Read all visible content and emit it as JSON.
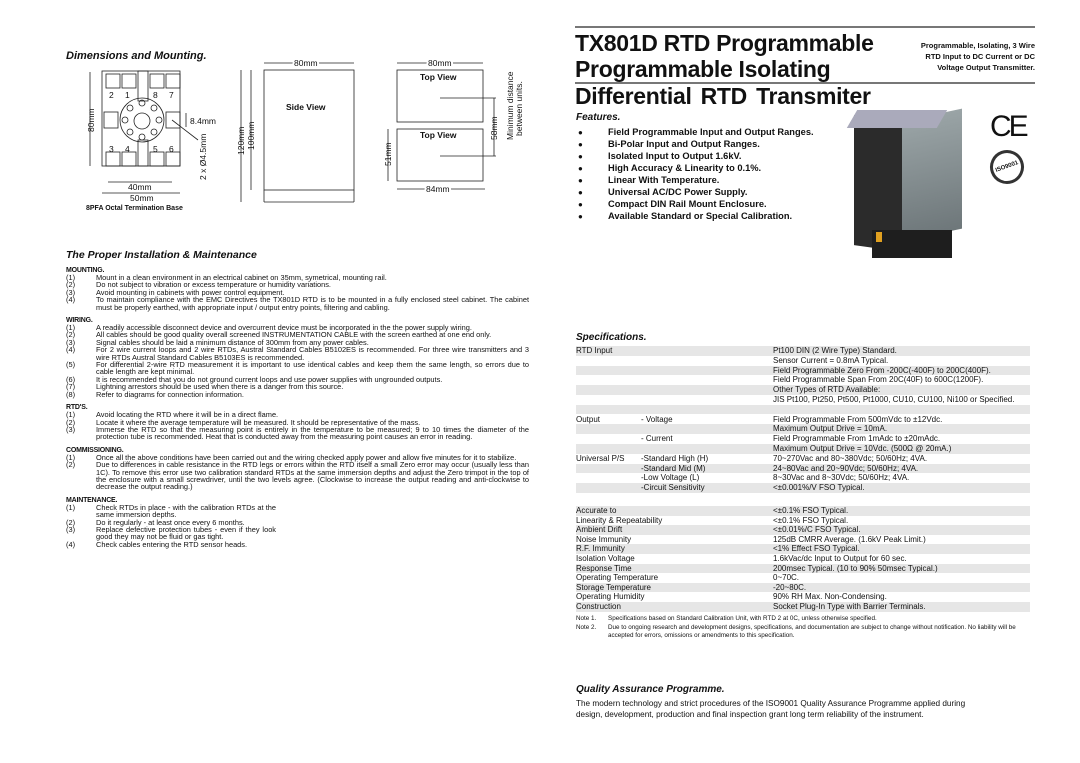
{
  "dimensions": {
    "heading": "Dimensions and Mounting.",
    "base_label": "8PFA Octal Termination Base",
    "base_terminals": [
      "2",
      "1",
      "8",
      "7",
      "3",
      "4",
      "5",
      "6"
    ],
    "dim_80mm_height": "80mm",
    "dim_8_4mm": "8.4mm",
    "dim_holes": "2 x Ø4.5mm",
    "dim_40mm": "40mm",
    "dim_50mm": "50mm",
    "side_view_label": "Side View",
    "side_width": "80mm",
    "side_120mm": "120mm",
    "side_100mm": "100mm",
    "top_view_label": "Top View",
    "top_width": "80mm",
    "top_51mm": "51mm",
    "top_84mm": "84mm",
    "top_58mm": "58mm",
    "min_distance": [
      "Minimum distance",
      "between units."
    ]
  },
  "installation": {
    "heading": "The Proper Installation & Maintenance",
    "sections": [
      {
        "title": "MOUNTING.",
        "items": [
          {
            "n": "(1)",
            "t": "Mount in a clean environment in an electrical cabinet on 35mm, symetrical, mounting rail."
          },
          {
            "n": "(2)",
            "t": "Do not subject to vibration or excess temperature or humidity variations."
          },
          {
            "n": "(3)",
            "t": "Avoid mounting in cabinets with power control equipment."
          },
          {
            "n": "(4)",
            "t": "To maintain compliance with the EMC Directives the TX801D RTD is to be mounted in a fully enclosed steel cabinet. The cabinet  must be properly earthed, with appropriate input / output entry points, filtering and cabling."
          }
        ]
      },
      {
        "title": "WIRING.",
        "items": [
          {
            "n": "(1)",
            "t": "A readily accessible disconnect device and overcurrent device must be incorporated in the the power supply wiring."
          },
          {
            "n": "(2)",
            "t": "All cables should be good quality overall screened INSTRUMENTATION CABLE with the screen earthed at one end only."
          },
          {
            "n": "(3)",
            "t": "Signal cables should be laid a minimum distance of 300mm from any power cables."
          },
          {
            "n": "(4)",
            "t": "For 2 wire current loops and 2 wire RTDs, Austral Standard Cables B5102ES is recommended.  For three wire transmitters and 3 wire RTDs Austral Standard Cables B5103ES is recommended."
          },
          {
            "n": "(5)",
            "t": "For differential 2-wire RTD measurement it is important to use identical cables and keep them the same length, so errors due to cable length are kept minimal."
          },
          {
            "n": "(6)",
            "t": "It is recommended that you do not ground current loops and use power supplies with ungrounded outputs."
          },
          {
            "n": "(7)",
            "t": "Lightning arrestors should be used when there is a danger from this source."
          },
          {
            "n": "(8)",
            "t": "Refer to diagrams for connection information."
          }
        ]
      },
      {
        "title": "RTD'S.",
        "items": [
          {
            "n": "(1)",
            "t": "Avoid locating the RTD where it will be in a direct flame."
          },
          {
            "n": "(2)",
            "t": "Locate it where the average temperature will be measured.  It should be representative of the mass."
          },
          {
            "n": "(3)",
            "t": "Immerse the RTD so that the measuring point is entirely in the temperature to be measured; 9 to 10 times the diameter of the protection tube is recommended. Heat that is conducted away from the measuring point causes an error in reading."
          }
        ]
      },
      {
        "title": "COMMISSIONING.",
        "items": [
          {
            "n": "(1)",
            "t": "Once all the above conditions have been carried out and the wiring checked apply power  and allow five minutes for it to stabilize."
          },
          {
            "n": "(2)",
            "t": "Due to differences in cable resistance in the RTD legs or errors within the RTD itself a small Zero error may occur (usually less than 1C).  To remove this error use two calibration standard RTDs at the same immersion depths and adjust the Zero trimpot in the top of the  enclosure with a small screwdriver, until the two levels agree. (Clockwise to increase the output reading and anti-clockwise to decrease the output reading.)"
          }
        ]
      },
      {
        "title": "MAINTENANCE.",
        "items": [
          {
            "n": "(1)",
            "t": "Check RTDs in place - with the calibration RTDs at the same immersion depths."
          },
          {
            "n": "(2)",
            "t": "Do it regularly - at least once every 6 months."
          },
          {
            "n": "(3)",
            "t": "Replace defective protection tubes - even if they look good they may not be fluid or gas tight."
          },
          {
            "n": "(4)",
            "t": "Check cables entering the RTD sensor heads."
          }
        ]
      }
    ]
  },
  "header": {
    "title_lines": [
      "TX801D RTD Programmable",
      "Programmable Isolating",
      "Differential  RTD  Transmiter"
    ],
    "subtitle": [
      "Programmable, Isolating, 3 Wire",
      "RTD Input to DC Current or DC",
      "Voltage Output Transmitter."
    ],
    "ce_mark": "CE",
    "iso_badge": "ISO9001"
  },
  "features": {
    "heading": "Features.",
    "items": [
      "Field Programmable Input and Output Ranges.",
      "Bi-Polar Input and Output Ranges.",
      "Isolated Input to Output 1.6kV.",
      "High Accuracy & Linearity to 0.1%.",
      "Linear With Temperature.",
      "Universal AC/DC Power Supply.",
      "Compact DIN Rail Mount Enclosure.",
      "Available Standard or Special Calibration."
    ]
  },
  "specifications": {
    "heading": "Specifications.",
    "group1": [
      [
        "RTD Input",
        "",
        "Pt100 DIN (2 Wire Type) Standard."
      ],
      [
        "",
        "",
        "Sensor Current = 0.8mA Typical."
      ],
      [
        "",
        "",
        "Field Programmable Zero From -200C(-400F) to 200C(400F)."
      ],
      [
        "",
        "",
        "Field Programmable Span From 20C(40F) to 600C(1200F)."
      ],
      [
        "",
        "",
        "Other Types of RTD Available:"
      ],
      [
        "",
        "",
        "JIS Pt100, Pt250, Pt500, Pt1000, CU10, CU100, Ni100 or Specified."
      ],
      [
        "",
        "",
        ""
      ],
      [
        "Output",
        "- Voltage",
        "Field Programmable From 500mVdc to ±12Vdc."
      ],
      [
        "",
        "",
        "Maximum Output Drive = 10mA."
      ],
      [
        "",
        "- Current",
        "Field Programmable From 1mAdc to ±20mAdc."
      ],
      [
        "",
        "",
        "Maximum Output Drive = 10Vdc. (500Ω @ 20mA.)"
      ],
      [
        "Universal P/S",
        "-Standard High (H)",
        "70~270Vac and 80~380Vdc; 50/60Hz; 4VA."
      ],
      [
        "",
        "-Standard Mid (M)",
        "24~80Vac and 20~90Vdc; 50/60Hz; 4VA."
      ],
      [
        "",
        "-Low Voltage (L)",
        "8~30Vac and 8~30Vdc; 50/60Hz; 4VA."
      ],
      [
        "",
        "-Circuit Sensitivity",
        "<±0.001%/V FSO Typical."
      ]
    ],
    "group2": [
      [
        "Accurate to",
        "<±0.1% FSO Typical."
      ],
      [
        "Linearity & Repeatability",
        "<±0.1% FSO Typical."
      ],
      [
        "Ambient Drift",
        "<±0.01%/C FSO Typical."
      ],
      [
        "Noise Immunity",
        "125dB CMRR Average. (1.6kV Peak Limit.)"
      ],
      [
        "R.F. Immunity",
        "<1% Effect FSO Typical."
      ],
      [
        "Isolation Voltage",
        "1.6kVac/dc Input to Output for 60 sec."
      ],
      [
        "Response Time",
        "200msec Typical. (10 to 90% 50msec Typical.)"
      ],
      [
        "Operating Temperature",
        "0~70C."
      ],
      [
        "Storage Temperature",
        "-20~80C."
      ],
      [
        "Operating Humidity",
        "90% RH Max. Non-Condensing."
      ],
      [
        "Construction",
        "Socket Plug-In Type with Barrier Terminals."
      ]
    ],
    "notes": [
      {
        "n": "Note 1.",
        "t": "Specifications based on Standard Calibration Unit, with RTD 2 at 0C, unless otherwise specified."
      },
      {
        "n": "Note 2.",
        "t": "Due to ongoing research and development designs, specifications, and documentation are subject to change without notification. No liability will be accepted for errors, omissions or amendments to this specification."
      }
    ]
  },
  "quality": {
    "heading": "Quality Assurance Programme.",
    "text": "The modern technology and strict procedures of the ISO9001 Quality Assurance Programme applied during design, development, production and final inspection grant long term reliability of the instrument."
  }
}
